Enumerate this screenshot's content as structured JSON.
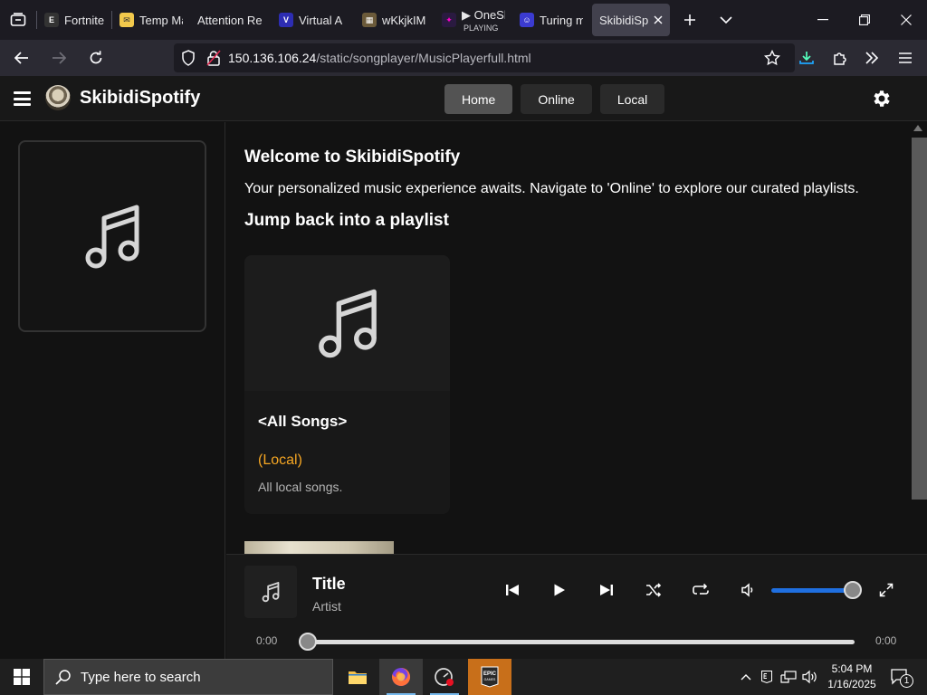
{
  "browser": {
    "tabs": [
      {
        "title": "Fortnite |",
        "icon": "epic-games-icon"
      },
      {
        "title": "Temp Ma",
        "icon": "mail-icon"
      },
      {
        "title": "Attention Re",
        "icon": ""
      },
      {
        "title": "Virtual A",
        "icon": "virtual-icon"
      },
      {
        "title": "wKkjkIM",
        "icon": "image-icon"
      },
      {
        "title": "▶ OneSh",
        "subtitle": "PLAYING",
        "icon": "oneshot-icon"
      },
      {
        "title": "Turing m",
        "icon": "turing-icon"
      },
      {
        "title": "SkibidiSpo",
        "icon": "",
        "active": true
      }
    ],
    "url_host": "150.136.106.24",
    "url_path": "/static/songplayer/MusicPlayerfull.html"
  },
  "app": {
    "brand": "SkibidiSpotify",
    "nav": [
      "Home",
      "Online",
      "Local"
    ],
    "active_nav": "Home"
  },
  "main": {
    "welcome_title": "Welcome to SkibidiSpotify",
    "welcome_text": "Your personalized music experience awaits. Navigate to 'Online' to explore our curated playlists.",
    "jump_back_title": "Jump back into a playlist",
    "playlist": {
      "name": "<All Songs>",
      "source": "(Local)",
      "description": "All local songs."
    }
  },
  "player": {
    "title": "Title",
    "artist": "Artist",
    "current_time": "0:00",
    "duration": "0:00",
    "volume": 1.0,
    "progress": 0.0
  },
  "taskbar": {
    "search_placeholder": "Type here to search",
    "time": "5:04 PM",
    "date": "1/16/2025",
    "notification_count": "1"
  },
  "colors": {
    "accent_source": "#f5a623",
    "volume_fill": "#1f6fe0",
    "active_nav_bg": "#535353"
  }
}
